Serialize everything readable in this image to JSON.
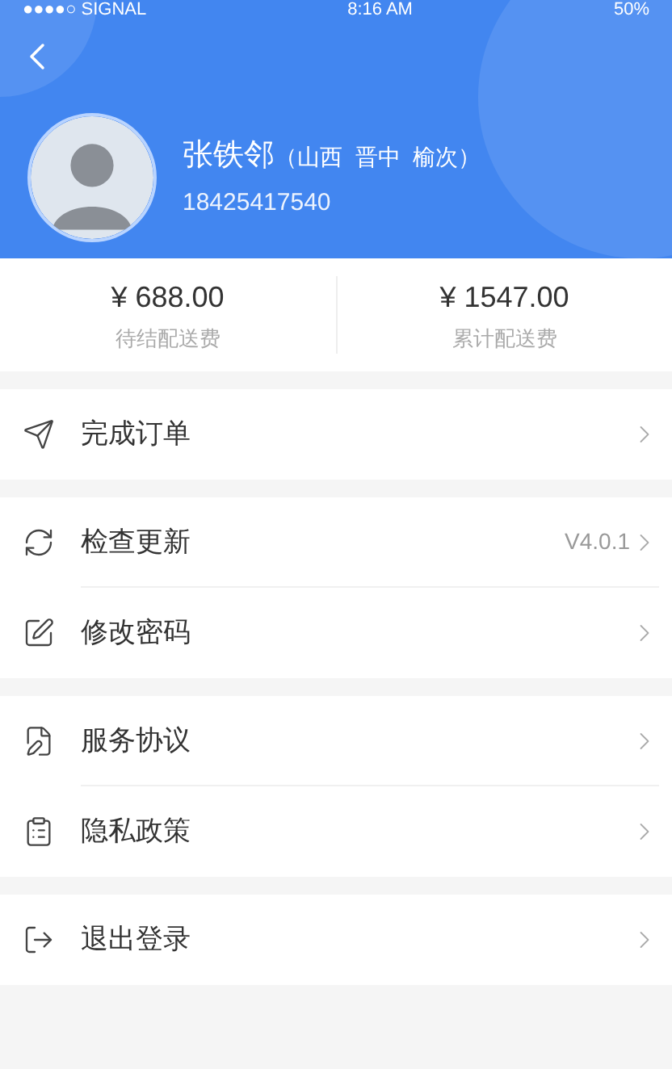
{
  "status_bar": {
    "signal": "●●●●○ SIGNAL",
    "time": "8:16 AM",
    "battery": "50%"
  },
  "profile": {
    "name": "张铁邻",
    "region": "（山西  晋中  榆次）",
    "phone": "18425417540"
  },
  "stats": [
    {
      "amount": "¥ 688.00",
      "label": "待结配送费"
    },
    {
      "amount": "¥ 1547.00",
      "label": "累计配送费"
    }
  ],
  "menu_groups": [
    [
      {
        "label": "完成订单"
      }
    ],
    [
      {
        "label": "检查更新",
        "value": "V4.0.1"
      },
      {
        "label": "修改密码"
      }
    ],
    [
      {
        "label": "服务协议"
      },
      {
        "label": "隐私政策"
      }
    ],
    [
      {
        "label": "退出登录"
      }
    ]
  ]
}
